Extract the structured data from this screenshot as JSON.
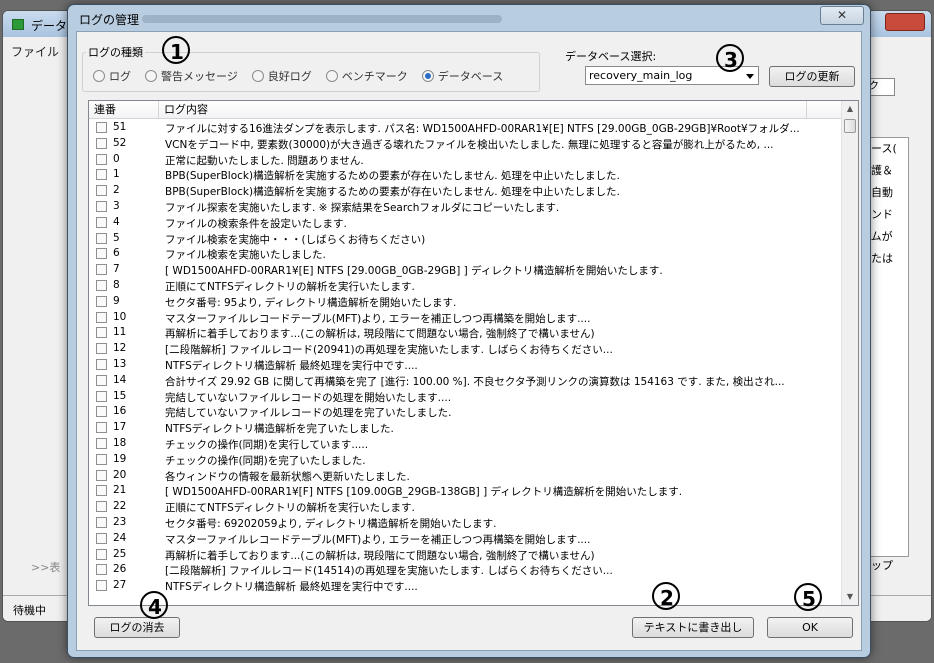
{
  "background_window": {
    "title": "データ",
    "menu": "ファイル",
    "tab_fragment": "ーク",
    "side_items": [
      "ベース(",
      "保護＆",
      "ン自動",
      "マンド",
      "ラムが",
      "または"
    ],
    "bottom_left": ">>表",
    "bottom_right": "ップ",
    "status": "待機中"
  },
  "dialog": {
    "title": "ログの管理",
    "close_label": "✕",
    "log_type": {
      "label": "ログの種類",
      "options": [
        {
          "label": "ログ",
          "checked": false
        },
        {
          "label": "警告メッセージ",
          "checked": false
        },
        {
          "label": "良好ログ",
          "checked": false
        },
        {
          "label": "ベンチマーク",
          "checked": false
        },
        {
          "label": "データベース",
          "checked": true
        }
      ]
    },
    "database_select": {
      "label": "データベース選択:",
      "value": "recovery_main_log"
    },
    "refresh_label": "ログの更新",
    "list": {
      "columns": [
        "連番",
        "ログ内容"
      ],
      "rows": [
        {
          "no": "51",
          "msg": "ファイルに対する16進法ダンプを表示します. パス名: WD1500AHFD-00RAR1¥[E] NTFS [29.00GB_0GB-29GB]¥Root¥フォルダ..."
        },
        {
          "no": "52",
          "msg": "VCNをデコード中, 要素数(30000)が大き過ぎる壊れたファイルを検出いたしました. 無理に処理すると容量が膨れ上がるため, ..."
        },
        {
          "no": "0",
          "msg": "正常に起動いたしました. 問題ありません."
        },
        {
          "no": "1",
          "msg": "BPB(SuperBlock)構造解析を実施するための要素が存在いたしません. 処理を中止いたしました."
        },
        {
          "no": "2",
          "msg": "BPB(SuperBlock)構造解析を実施するための要素が存在いたしません. 処理を中止いたしました."
        },
        {
          "no": "3",
          "msg": "ファイル探索を実施いたします. ※ 探索結果をSearchフォルダにコピーいたします."
        },
        {
          "no": "4",
          "msg": "ファイルの検索条件を設定いたします."
        },
        {
          "no": "5",
          "msg": "ファイル検索を実施中・・・(しばらくお待ちください)"
        },
        {
          "no": "6",
          "msg": "ファイル検索を実施いたしました."
        },
        {
          "no": "7",
          "msg": "[ WD1500AHFD-00RAR1¥[E] NTFS [29.00GB_0GB-29GB] ] ディレクトリ構造解析を開始いたします."
        },
        {
          "no": "8",
          "msg": "正順にてNTFSディレクトリの解析を実行いたします."
        },
        {
          "no": "9",
          "msg": "セクタ番号: 95より, ディレクトリ構造解析を開始いたします."
        },
        {
          "no": "10",
          "msg": "マスターファイルレコードテーブル(MFT)より, エラーを補正しつつ再構築を開始します...."
        },
        {
          "no": "11",
          "msg": "再解析に着手しております...(この解析は, 現段階にて問題ない場合, 強制終了で構いません)"
        },
        {
          "no": "12",
          "msg": "[二段階解析] ファイルレコード(20941)の再処理を実施いたします. しばらくお待ちください..."
        },
        {
          "no": "13",
          "msg": "NTFSディレクトリ構造解析 最終処理を実行中です...."
        },
        {
          "no": "14",
          "msg": "合計サイズ 29.92 GB に関して再構築を完了 [進行: 100.00 %]. 不良セクタ予測リンクの演算数は 154163 です. また, 検出され..."
        },
        {
          "no": "15",
          "msg": "完結していないファイルレコードの処理を開始いたします...."
        },
        {
          "no": "16",
          "msg": "完結していないファイルレコードの処理を完了いたしました."
        },
        {
          "no": "17",
          "msg": "NTFSディレクトリ構造解析を完了いたしました."
        },
        {
          "no": "18",
          "msg": "チェックの操作(同期)を実行しています....."
        },
        {
          "no": "19",
          "msg": "チェックの操作(同期)を完了いたしました."
        },
        {
          "no": "20",
          "msg": "各ウィンドウの情報を最新状態へ更新いたしました."
        },
        {
          "no": "21",
          "msg": "[ WD1500AHFD-00RAR1¥[F] NTFS [109.00GB_29GB-138GB] ] ディレクトリ構造解析を開始いたします."
        },
        {
          "no": "22",
          "msg": "正順にてNTFSディレクトリの解析を実行いたします."
        },
        {
          "no": "23",
          "msg": "セクタ番号: 69202059より, ディレクトリ構造解析を開始いたします."
        },
        {
          "no": "24",
          "msg": "マスターファイルレコードテーブル(MFT)より, エラーを補正しつつ再構築を開始します...."
        },
        {
          "no": "25",
          "msg": "再解析に着手しております...(この解析は, 現段階にて問題ない場合, 強制終了で構いません)"
        },
        {
          "no": "26",
          "msg": "[二段階解析] ファイルレコード(14514)の再処理を実施いたします. しばらくお待ちください..."
        },
        {
          "no": "27",
          "msg": "NTFSディレクトリ構造解析 最終処理を実行中です...."
        }
      ]
    },
    "clear_label": "ログの消去",
    "export_label": "テキストに書き出し",
    "ok_label": "OK"
  },
  "callouts": [
    "1",
    "2",
    "3",
    "4",
    "5"
  ],
  "colors": {
    "accent": "#2a6dc4",
    "dialog_frame": "#b8cde0"
  }
}
